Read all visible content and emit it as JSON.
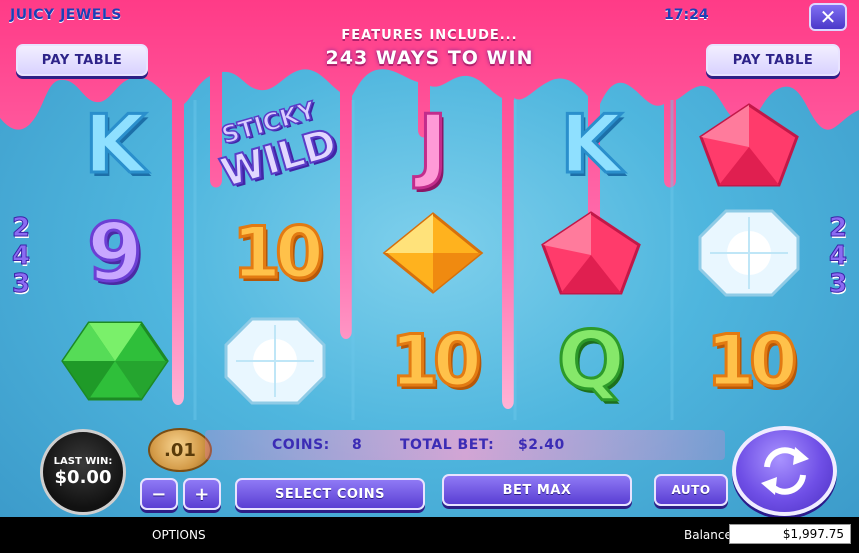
{
  "game": {
    "title": "JUICY JEWELS",
    "clock": "17:24",
    "close_icon": "close-icon"
  },
  "features": {
    "line1": "FEATURES INCLUDE...",
    "line2": "243 WAYS TO WIN"
  },
  "buttons": {
    "paytable_left": "PAY TABLE",
    "paytable_right": "PAY TABLE",
    "minus": "−",
    "plus": "+",
    "select_coins": "SELECT COINS",
    "bet_max": "BET MAX",
    "auto": "AUTO"
  },
  "ways_badge": {
    "left_digits": [
      "2",
      "4",
      "3"
    ],
    "right_digits": [
      "2",
      "4",
      "3"
    ]
  },
  "reels": [
    {
      "symbols": [
        "K",
        "9",
        "green-gem"
      ]
    },
    {
      "symbols": [
        "sticky-wild",
        "10",
        "diamond"
      ]
    },
    {
      "symbols": [
        "J",
        "yellow-gem",
        "10"
      ]
    },
    {
      "symbols": [
        "K",
        "red-gem",
        "Q"
      ]
    },
    {
      "symbols": [
        "red-gem",
        "diamond",
        "10"
      ]
    }
  ],
  "sticky_wild": {
    "line1": "STICKY",
    "line2": "WILD"
  },
  "last_win": {
    "label": "LAST WIN:",
    "value": "$0.00"
  },
  "coin_value": ".01",
  "bet_info": {
    "coins_label": "COINS:",
    "coins_value": "8",
    "total_bet_label": "TOTAL BET:",
    "total_bet_value": "$2.40"
  },
  "footer": {
    "options": "OPTIONS",
    "balance_label": "Balance",
    "balance_value": "$1,997.75"
  },
  "colors": {
    "reel_bg": "#4fb6de",
    "candy_pink": "#ff4f9a",
    "button_purple": "#5a3fd3"
  }
}
